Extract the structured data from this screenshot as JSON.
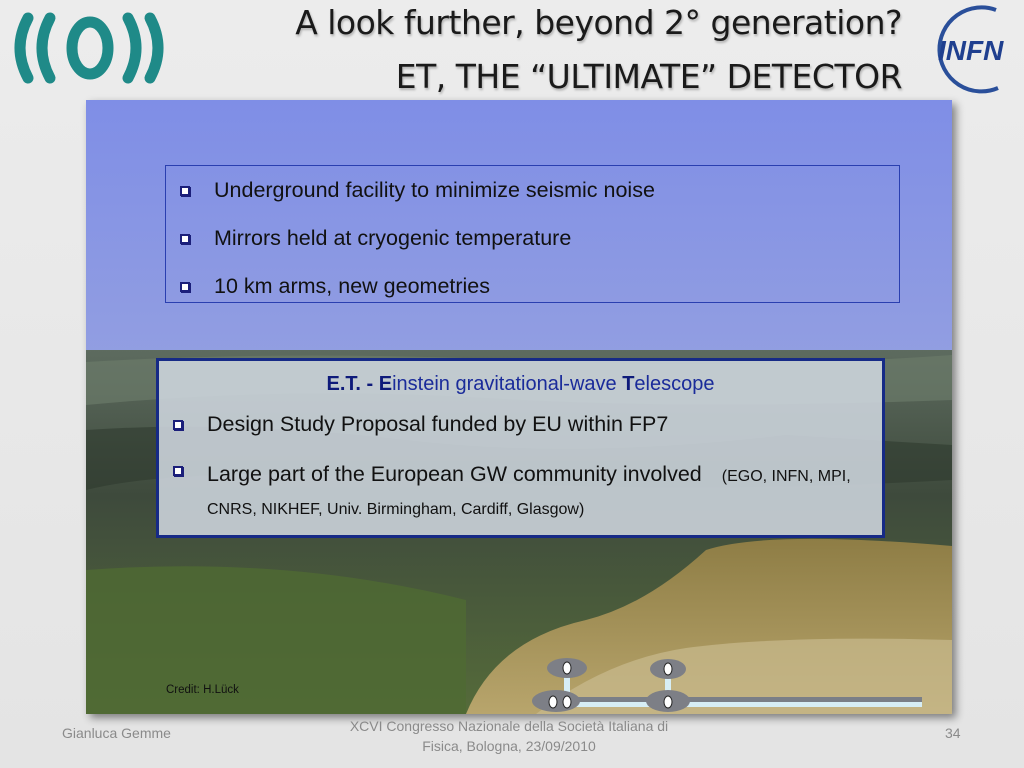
{
  "header": {
    "title_line1": "A look further, beyond 2° generation?",
    "title_line2": "ET, THE “ULTIMATE” DETECTOR",
    "logo_right_text": "INFN"
  },
  "top_box": {
    "bullets": [
      "Underground facility to minimize seismic noise",
      "Mirrors held at cryogenic temperature",
      "10 km arms, new geometries"
    ]
  },
  "mid_box": {
    "heading_abbr": "E.T. - ",
    "heading_E": "E",
    "heading_mid": "instein gravitational-wave ",
    "heading_T": "T",
    "heading_end": "elescope",
    "bullet1": "Design Study Proposal funded by EU within FP7",
    "bullet2_main": "Large part of the European GW community involved",
    "bullet2_small": "(EGO, INFN, MPI, CNRS, NIKHEF, Univ. Birmingham, Cardiff, Glasgow)"
  },
  "credit": "Credit: H.Lück",
  "footer": {
    "author": "Gianluca Gemme",
    "conference": "XCVI Congresso Nazionale della Società Italiana di Fisica, Bologna, 23/09/2010",
    "page_number": "34"
  },
  "colors": {
    "title_text": "#1a1a1a",
    "box_border": "#162a86",
    "bullet_blue": "#1b1f7a",
    "heading_blue": "#1a2b9a",
    "sky_top": "#7f8ee6",
    "ground_sand": "#9f8e55",
    "logo_teal": "#1f8a88"
  }
}
